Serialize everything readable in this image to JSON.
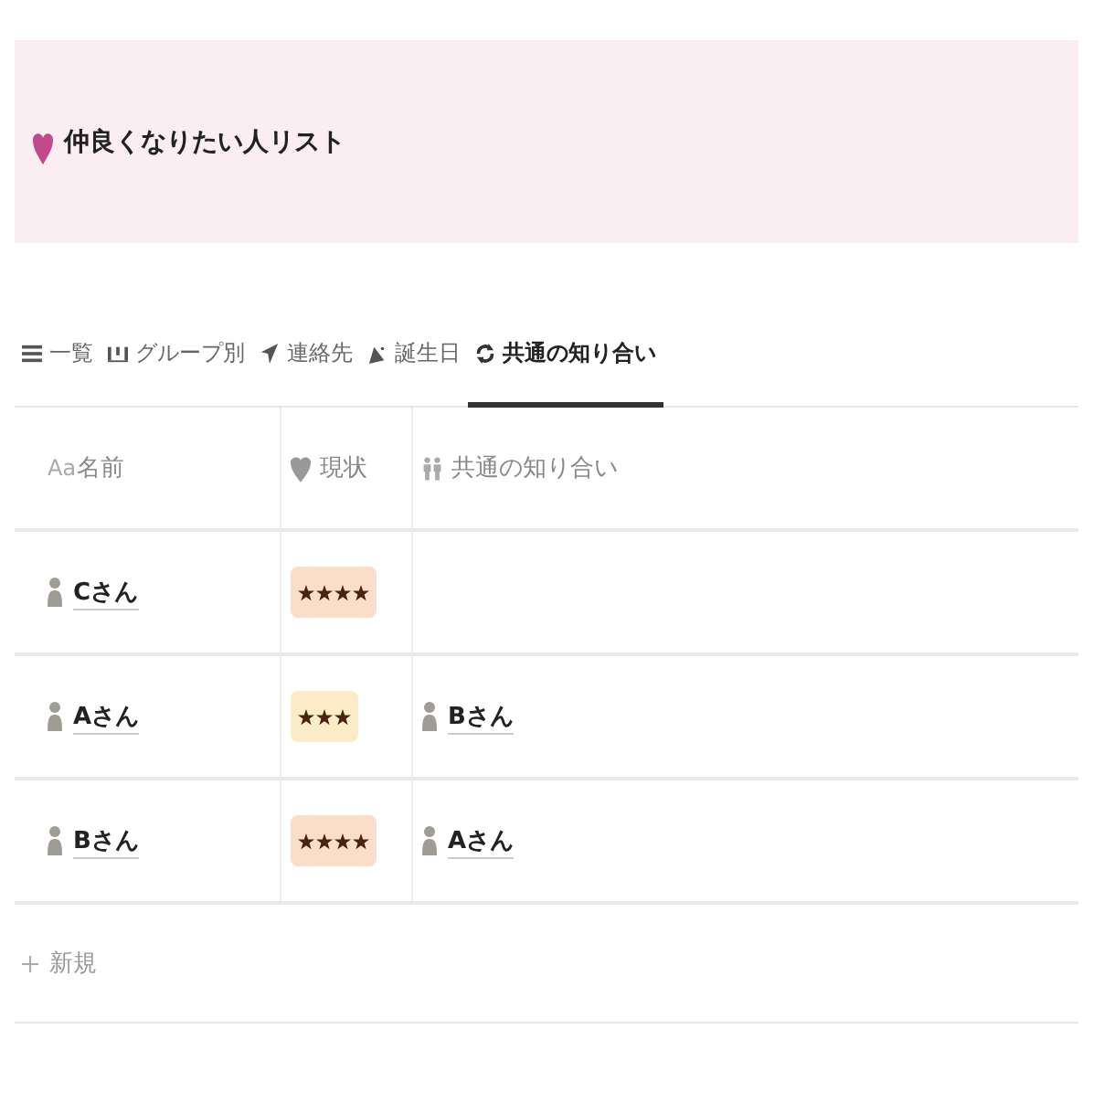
{
  "banner": {
    "title": "仲良くなりたい人リスト"
  },
  "tabs": [
    {
      "label": "一覧",
      "kind": "list",
      "selected": false
    },
    {
      "label": "グループ別",
      "kind": "board",
      "selected": false
    },
    {
      "label": "連絡先",
      "kind": "send",
      "selected": false
    },
    {
      "label": "誕生日",
      "kind": "party",
      "selected": false
    },
    {
      "label": "共通の知り合い",
      "kind": "sync",
      "selected": true
    }
  ],
  "table": {
    "columns": [
      {
        "label": "名前",
        "kind": "title",
        "icon_text": "Aa"
      },
      {
        "label": "現状",
        "kind": "heart"
      },
      {
        "label": "共通の知り合い",
        "kind": "people"
      }
    ],
    "rows": [
      {
        "name": "Cさん",
        "stars": 4,
        "color": "#fadec9",
        "mutual": []
      },
      {
        "name": "Aさん",
        "stars": 3,
        "color": "#fdecc8",
        "mutual": [
          "Bさん"
        ]
      },
      {
        "name": "Bさん",
        "stars": 4,
        "color": "#fadec9",
        "mutual": [
          "Aさん"
        ]
      }
    ],
    "new_label": "新規"
  }
}
